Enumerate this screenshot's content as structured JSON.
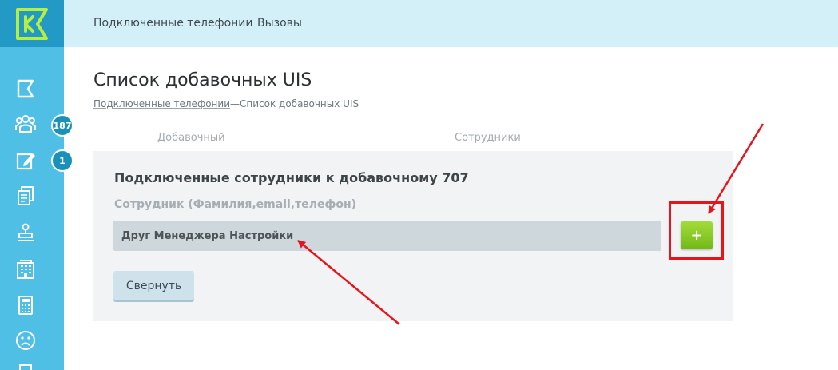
{
  "topnav": {
    "connected_phones": "Подключенные телефонии",
    "calls": "Вызовы"
  },
  "sidebar": {
    "badge_employees": "187",
    "badge_tasks": "1",
    "icons": [
      "flag-icon",
      "team-icon",
      "edit-icon",
      "documents-icon",
      "stamp-icon",
      "building-icon",
      "calculator-icon",
      "sad-face-icon",
      "misc-icon"
    ]
  },
  "page": {
    "title": "Список добавочных UIS",
    "breadcrumb_link": "Подключенные телефонии",
    "breadcrumb_sep": "—",
    "breadcrumb_current": "Список добавочных UIS",
    "col_extension": "Добавочный",
    "col_employees": "Сотрудники"
  },
  "panel": {
    "title": "Подключенные сотрудники к добавочному 707",
    "field_label": "Сотрудник (Фамилия,email,телефон)",
    "field_value": "Друг Менеджера Настройки",
    "add_label": "+",
    "collapse_label": "Свернуть"
  },
  "colors": {
    "sidebar": "#4fbfe6",
    "topbar": "#d3f0f8",
    "accent_green": "#8ccb2a",
    "annotation_red": "#e8131b"
  }
}
